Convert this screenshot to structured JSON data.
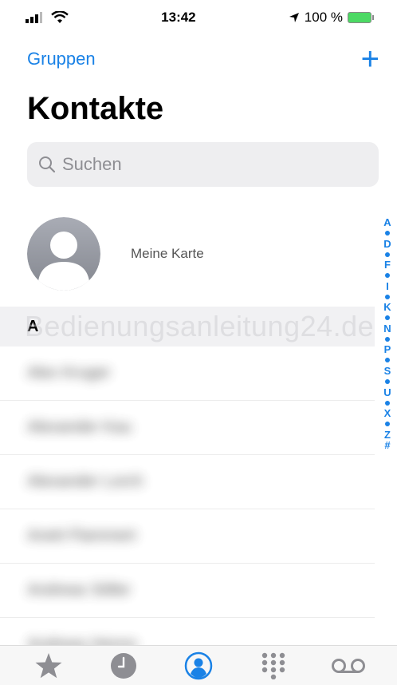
{
  "status_bar": {
    "time": "13:42",
    "battery_percent": "100 %"
  },
  "nav": {
    "groups_label": "Gruppen",
    "add_label": "+"
  },
  "page": {
    "title": "Kontakte"
  },
  "search": {
    "placeholder": "Suchen"
  },
  "my_card": {
    "label": "Meine Karte"
  },
  "watermark": "Bedienungsanleitung24.de",
  "section": {
    "letter": "A"
  },
  "contacts": [
    {
      "name": "Alex Kruger"
    },
    {
      "name": "Alexander Kau"
    },
    {
      "name": "Alexander Lorch"
    },
    {
      "name": "Anett Flammert"
    },
    {
      "name": "Andreas Stiller"
    },
    {
      "name": "Andreas Henns"
    }
  ],
  "index_letters": [
    "A",
    "•",
    "D",
    "•",
    "F",
    "•",
    "I",
    "•",
    "K",
    "•",
    "N",
    "•",
    "P",
    "•",
    "S",
    "•",
    "U",
    "•",
    "X",
    "•",
    "Z",
    "#"
  ],
  "tab_bar": [
    {
      "name": "favorites",
      "icon": "star-icon"
    },
    {
      "name": "recents",
      "icon": "clock-icon"
    },
    {
      "name": "contacts",
      "icon": "person-circle-icon",
      "active": true
    },
    {
      "name": "keypad",
      "icon": "keypad-icon"
    },
    {
      "name": "voicemail",
      "icon": "voicemail-icon"
    }
  ],
  "colors": {
    "accent": "#1a82e6",
    "inactive_tab": "#8e8e93",
    "battery": "#4cd964"
  }
}
